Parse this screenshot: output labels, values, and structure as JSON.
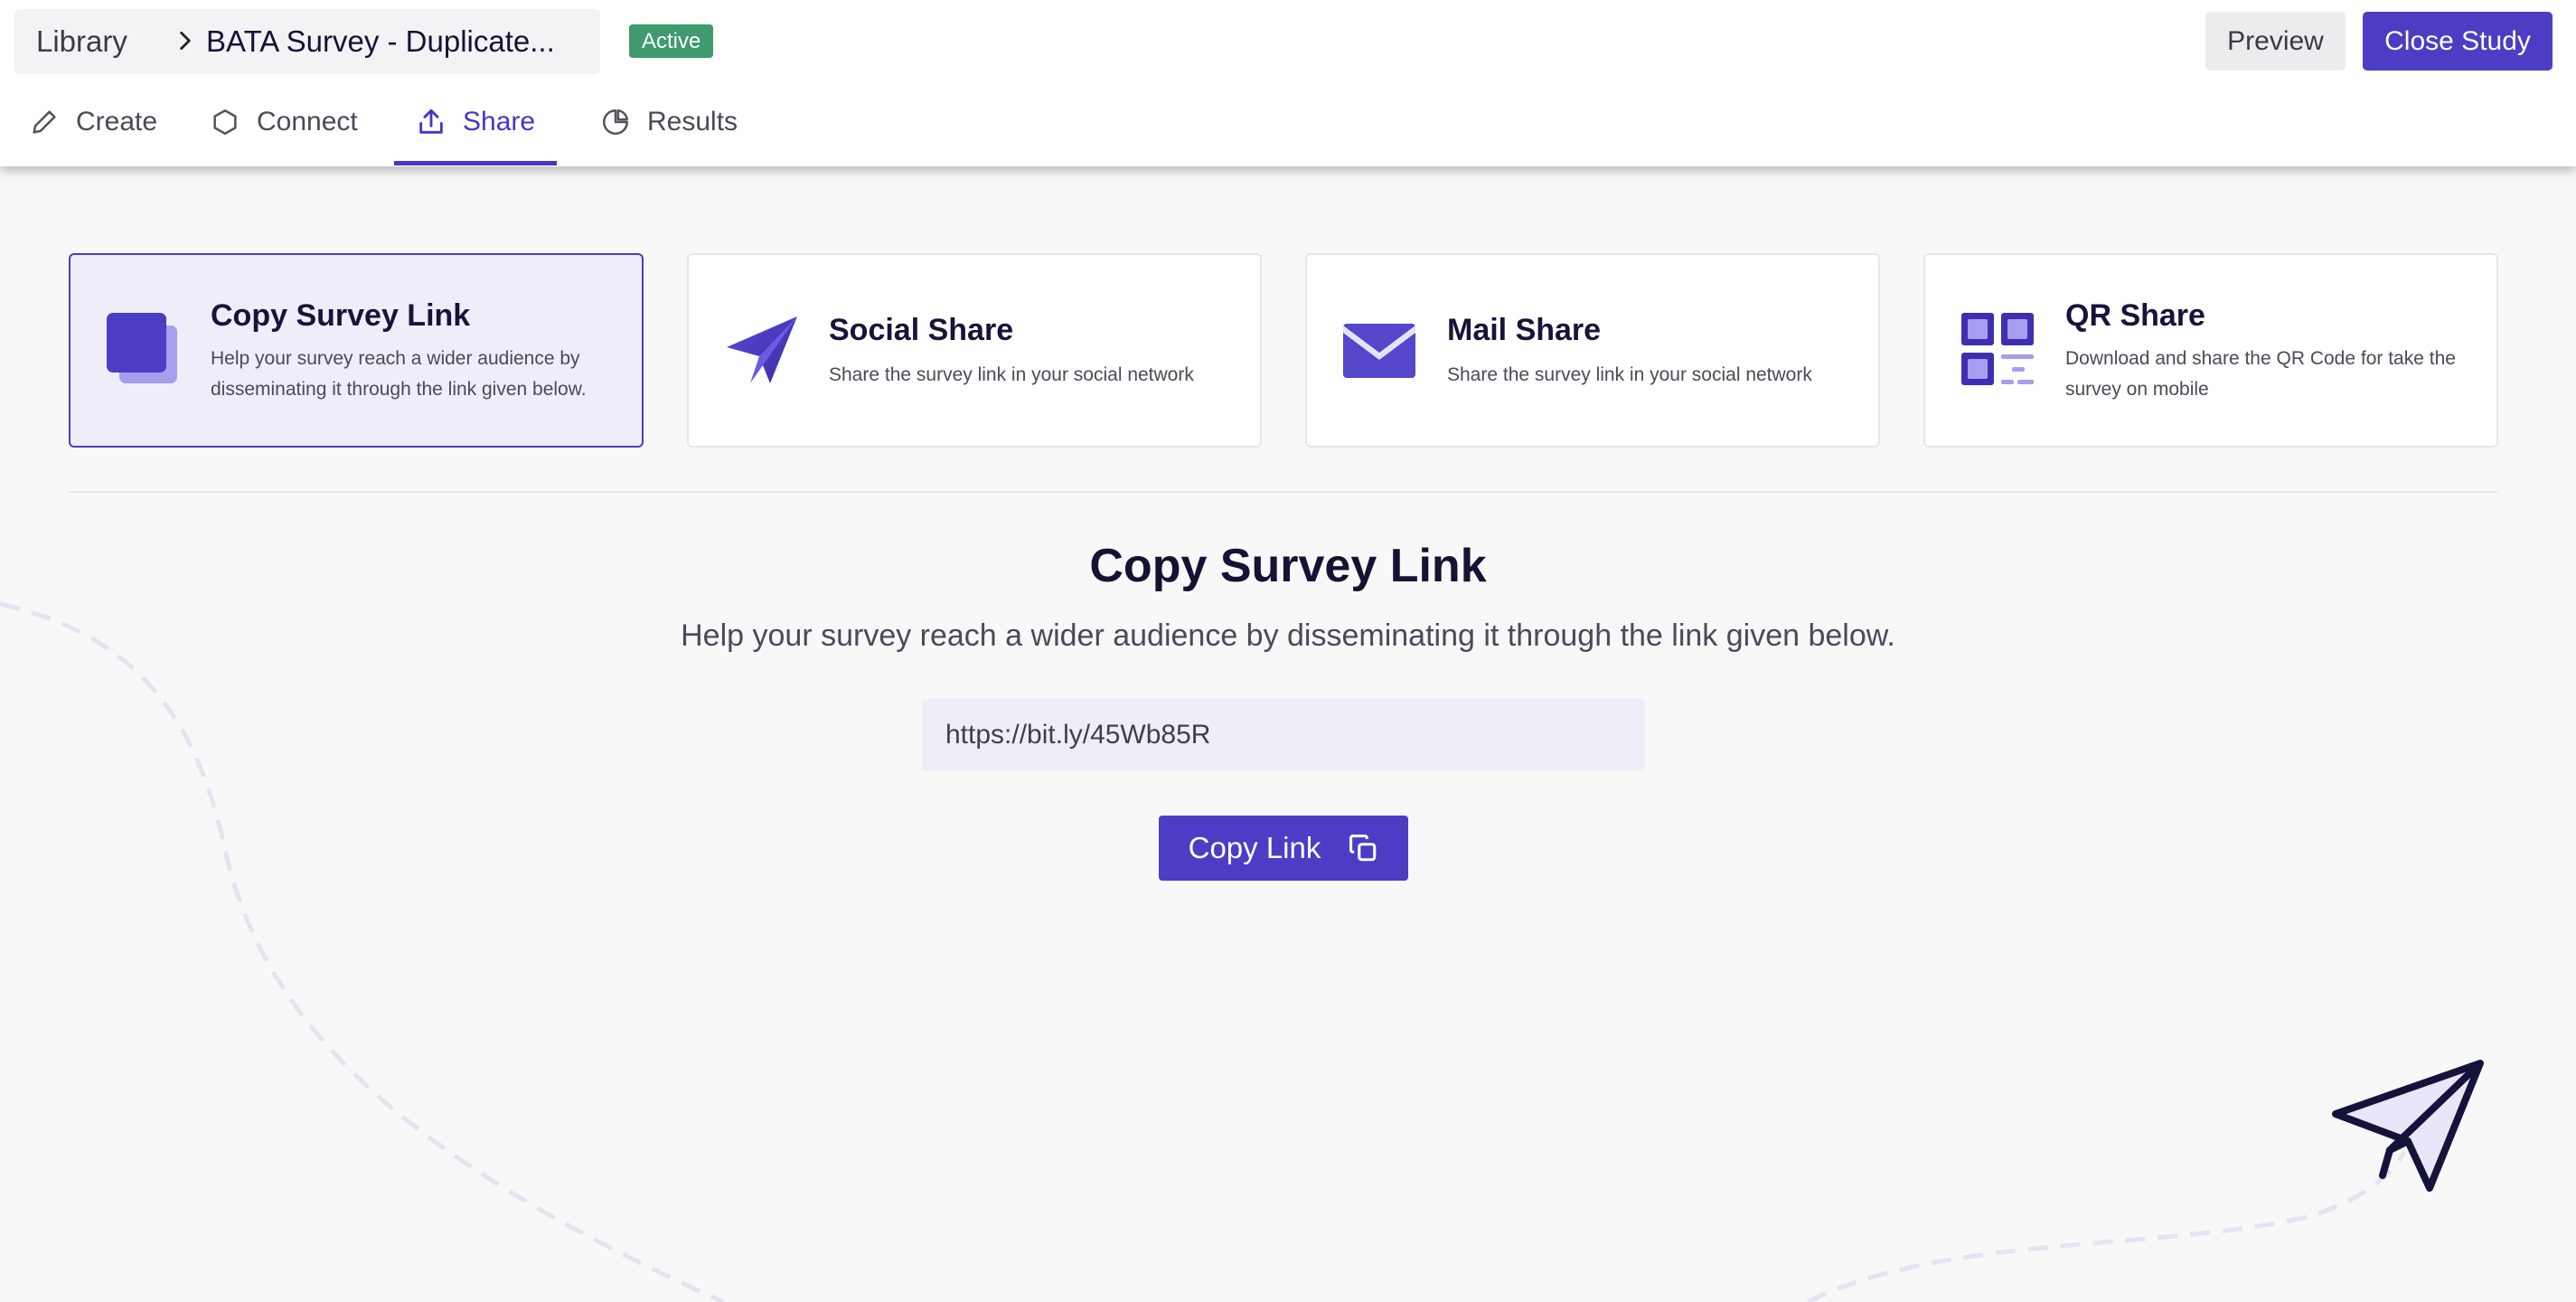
{
  "header": {
    "breadcrumb_root": "Library",
    "study_title": "BATA Survey - Duplicate...",
    "status": "Active",
    "preview_label": "Preview",
    "close_label": "Close Study"
  },
  "tabs": [
    {
      "label": "Create",
      "icon": "pencil-icon"
    },
    {
      "label": "Connect",
      "icon": "hexagon-icon"
    },
    {
      "label": "Share",
      "icon": "upload-share-icon",
      "active": true
    },
    {
      "label": "Results",
      "icon": "pie-chart-icon"
    }
  ],
  "share_options": [
    {
      "title": "Copy Survey Link",
      "description": "Help your survey reach a wider audience by disseminating it through the link given below.",
      "icon": "copy-squares-icon",
      "selected": true
    },
    {
      "title": "Social Share",
      "description": "Share the survey link in your social network",
      "icon": "paper-plane-icon"
    },
    {
      "title": "Mail Share",
      "description": "Share the survey link in your social network",
      "icon": "envelope-icon"
    },
    {
      "title": "QR Share",
      "description": "Download and share the QR Code for take the survey on mobile",
      "icon": "qr-code-icon"
    }
  ],
  "main": {
    "title": "Copy Survey Link",
    "subtitle": "Help your survey reach a wider audience by disseminating it through the link given below.",
    "link_value": "https://bit.ly/45Wb85R",
    "copy_button_label": "Copy Link"
  },
  "colors": {
    "accent": "#4d3cc4",
    "active_badge": "#3f9a6d",
    "selected_card_bg": "#efedfa"
  }
}
